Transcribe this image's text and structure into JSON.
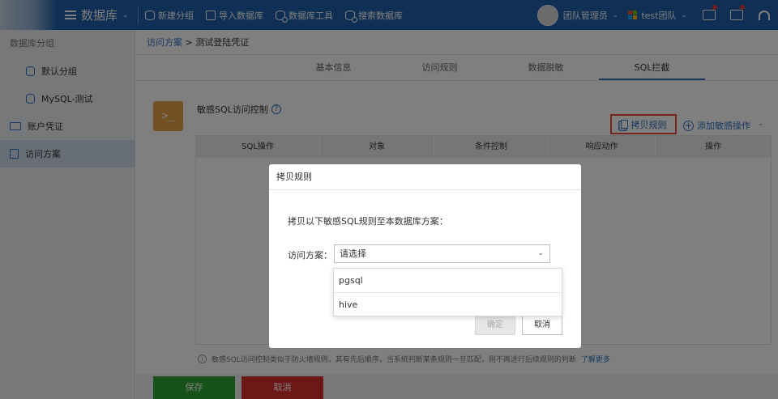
{
  "header": {
    "menu_title": "数据库",
    "toolbar": [
      {
        "label": "新建分组",
        "icon": "new-group-icon"
      },
      {
        "label": "导入数据库",
        "icon": "import-db-icon"
      },
      {
        "label": "数据库工具",
        "icon": "db-tools-icon"
      },
      {
        "label": "搜索数据库",
        "icon": "search-db-icon"
      }
    ],
    "user_name": "团队管理员",
    "team_name": "test团队",
    "team_logo_colors": [
      "#f25022",
      "#7fba00",
      "#00a4ef",
      "#ffb900"
    ]
  },
  "sidebar": {
    "group_label": "数据库分组",
    "items": [
      {
        "label": "默认分组",
        "icon": "database-icon"
      },
      {
        "label": "MySQL-测试",
        "icon": "database-icon"
      },
      {
        "label": "账户凭证",
        "icon": "id-card-icon"
      },
      {
        "label": "访问方案",
        "icon": "document-icon"
      }
    ]
  },
  "breadcrumb": {
    "parent": "访问方案",
    "separator": " > ",
    "current": "测试登陆凭证"
  },
  "tabs": [
    "基本信息",
    "访问规则",
    "数据脱敏",
    "SQL拦截"
  ],
  "section": {
    "icon_text": ">_",
    "title": "敏感SQL访问控制",
    "help": "?"
  },
  "actions": {
    "copy_rule": "拷贝规则",
    "add_op": "添加敏感操作"
  },
  "table": {
    "columns": [
      "SQL操作",
      "对象",
      "条件控制",
      "响应动作",
      "操作"
    ]
  },
  "notice": {
    "info": "i",
    "text": "敏感SQL访问控制类似于防火墙规则，其有先后顺序，当系统判断某条规则一旦匹配，则不再进行后续规则的判断",
    "more": "了解更多"
  },
  "footer": {
    "save": "保存",
    "cancel": "取消"
  },
  "modal": {
    "title": "拷贝规则",
    "description": "拷贝以下敏感SQL规则至本数据库方案：",
    "field_label": "访问方案：",
    "select_placeholder": "请选择",
    "options": [
      "pgsql",
      "hive"
    ],
    "ok": "确定",
    "cancel": "取消"
  },
  "colors": {
    "brand": "#1f5fa8",
    "accent": "#2f73c0",
    "save": "#2ea633",
    "cancel": "#d9302c",
    "highlight": "#e84a3c"
  }
}
